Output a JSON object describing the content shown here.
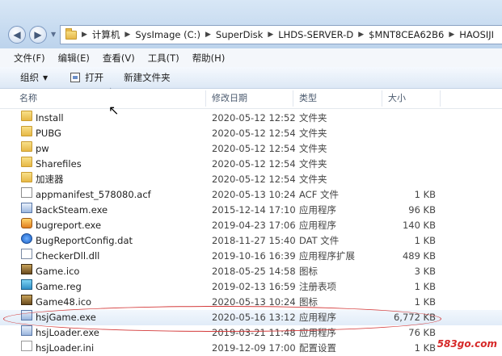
{
  "address": {
    "breadcrumbs": [
      "计算机",
      "SysImage (C:)",
      "SuperDisk",
      "LHDS-SERVER-D",
      "$MNT8CEA62B6",
      "HAOSIJI"
    ]
  },
  "menu": [
    "文件(F)",
    "编辑(E)",
    "查看(V)",
    "工具(T)",
    "帮助(H)"
  ],
  "toolbar": {
    "organize": "组织",
    "open": "打开",
    "new_folder": "新建文件夹"
  },
  "columns": {
    "name": "名称",
    "date": "修改日期",
    "type": "类型",
    "size": "大小"
  },
  "files": [
    {
      "name": "Install",
      "date": "2020-05-12 12:52",
      "type": "文件夹",
      "size": "",
      "icon": "folder-icon"
    },
    {
      "name": "PUBG",
      "date": "2020-05-12 12:54",
      "type": "文件夹",
      "size": "",
      "icon": "folder-icon"
    },
    {
      "name": "pw",
      "date": "2020-05-12 12:54",
      "type": "文件夹",
      "size": "",
      "icon": "folder-icon"
    },
    {
      "name": "Sharefiles",
      "date": "2020-05-12 12:54",
      "type": "文件夹",
      "size": "",
      "icon": "folder-icon"
    },
    {
      "name": "加速器",
      "date": "2020-05-12 12:54",
      "type": "文件夹",
      "size": "",
      "icon": "folder-icon"
    },
    {
      "name": "appmanifest_578080.acf",
      "date": "2020-05-13 10:24",
      "type": "ACF 文件",
      "size": "1 KB",
      "icon": "document-icon"
    },
    {
      "name": "BackSteam.exe",
      "date": "2015-12-14 17:10",
      "type": "应用程序",
      "size": "96 KB",
      "icon": "exe-icon"
    },
    {
      "name": "bugreport.exe",
      "date": "2019-04-23 17:06",
      "type": "应用程序",
      "size": "140 KB",
      "icon": "app-icon"
    },
    {
      "name": "BugReportConfig.dat",
      "date": "2018-11-27 15:40",
      "type": "DAT 文件",
      "size": "1 KB",
      "icon": "config-icon"
    },
    {
      "name": "CheckerDll.dll",
      "date": "2019-10-16 16:39",
      "type": "应用程序扩展",
      "size": "489 KB",
      "icon": "dll-icon"
    },
    {
      "name": "Game.ico",
      "date": "2018-05-25 14:58",
      "type": "图标",
      "size": "3 KB",
      "icon": "game-icon"
    },
    {
      "name": "Game.reg",
      "date": "2019-02-13 16:59",
      "type": "注册表项",
      "size": "1 KB",
      "icon": "registry-icon"
    },
    {
      "name": "Game48.ico",
      "date": "2020-05-13 10:24",
      "type": "图标",
      "size": "1 KB",
      "icon": "game-icon"
    },
    {
      "name": "hsjGame.exe",
      "date": "2020-05-16 13:12",
      "type": "应用程序",
      "size": "6,772 KB",
      "icon": "exe-icon"
    },
    {
      "name": "hsjLoader.exe",
      "date": "2019-03-21 11:48",
      "type": "应用程序",
      "size": "76 KB",
      "icon": "exe-icon"
    },
    {
      "name": "hsjLoader.ini",
      "date": "2019-12-09 17:00",
      "type": "配置设置",
      "size": "1 KB",
      "icon": "ini-icon"
    }
  ],
  "watermark": "583go.com",
  "colors": {
    "highlight": "#d43a3a",
    "address_bg": "#c8dcf0"
  }
}
